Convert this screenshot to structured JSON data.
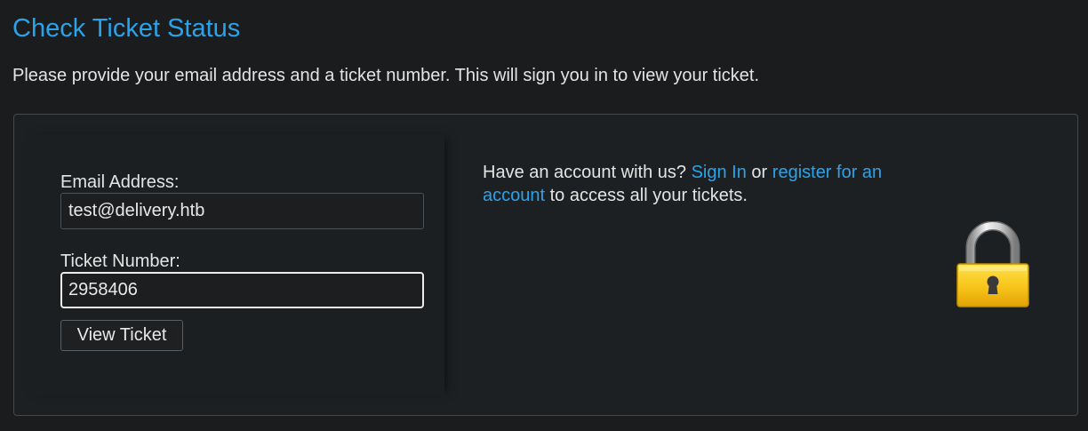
{
  "page": {
    "title": "Check Ticket Status",
    "intro": "Please provide your email address and a ticket number. This will sign you in to view your ticket."
  },
  "form": {
    "email_label": "Email Address:",
    "email_value": "test@delivery.htb",
    "ticket_label": "Ticket Number:",
    "ticket_value": "2958406",
    "submit_label": "View Ticket"
  },
  "account": {
    "prefix": "Have an account with us?",
    "sign_in_link": "Sign In",
    "or_text": "or",
    "register_link": "register for an account",
    "suffix": "to access all your tickets."
  },
  "icons": {
    "lock": "lock-icon"
  },
  "colors": {
    "accent": "#2aa3ea",
    "background": "#1b1c1d",
    "text": "#e4e4e4"
  }
}
